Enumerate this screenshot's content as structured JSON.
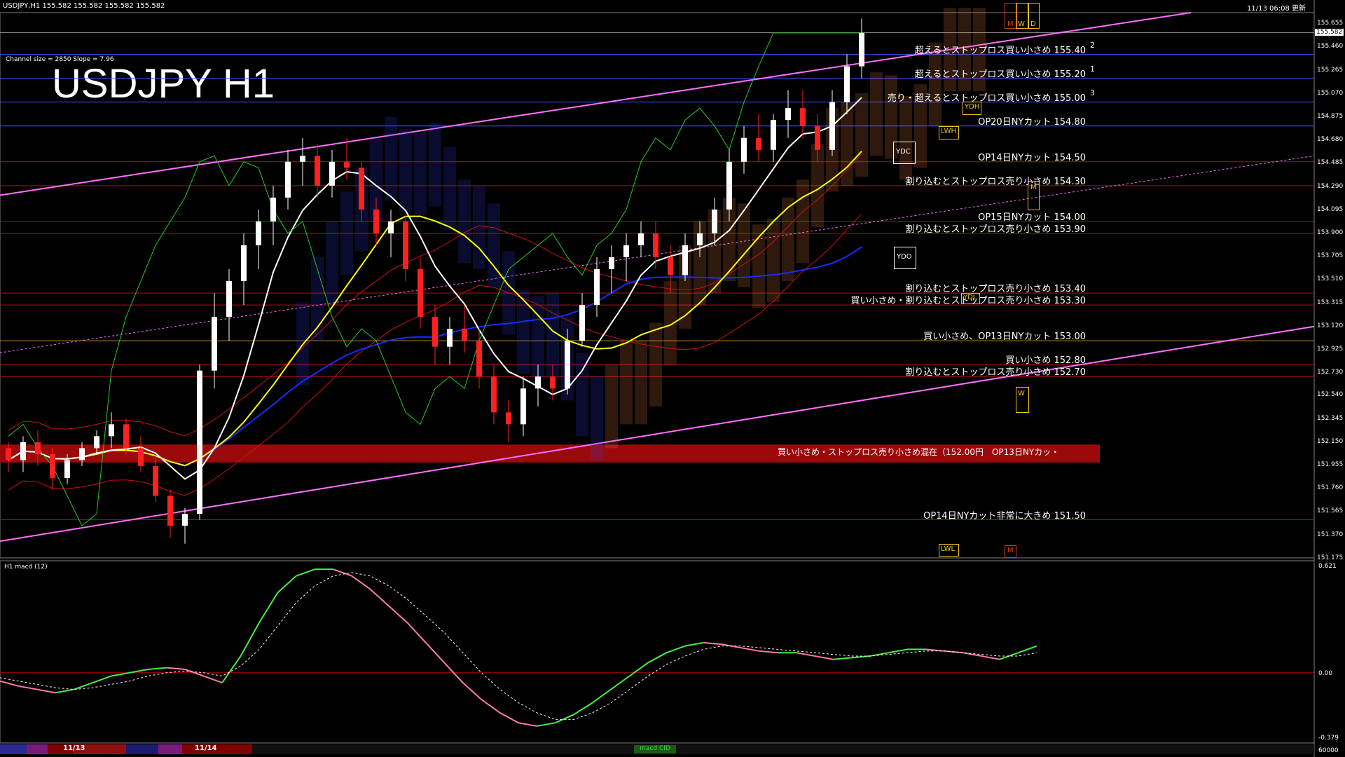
{
  "header": {
    "symbol_info": "USDJPY,H1  155.582 155.582 155.582 155.582",
    "datetime": "11/13 06:08 更新",
    "channel_info": "Channel size = 2850 Slope = 7.96",
    "title": "USDJPY H1"
  },
  "colors": {
    "background": "#000000",
    "bull_candle": "#ffffff",
    "bear_candle": "#ff2020",
    "sma_white": "#ffffff",
    "sma_yellow": "#ffff00",
    "sma_blue": "#1a2bff",
    "chikou_green": "#22cc22",
    "bollinger_red": "#cc1010",
    "channel_pink": "#ff70ff",
    "level_red": "#b01010",
    "level_blue": "#3a5aff",
    "kumo_orange": "#ff8a40",
    "kumo_blue": "#3040ff",
    "macd_up": "#44ee44",
    "macd_down": "#ff7ab0",
    "box_gold": "#f0c020"
  },
  "chart_data": {
    "type": "candlestick",
    "symbol": "USDJPY",
    "timeframe": "H1",
    "current_price": 155.582,
    "ylim": [
      151.18,
      155.75
    ],
    "y_ticks": [
      "155.655",
      "155.460",
      "155.265",
      "155.070",
      "154.875",
      "154.680",
      "154.485",
      "154.290",
      "154.095",
      "153.900",
      "153.705",
      "153.510",
      "153.315",
      "153.120",
      "152.925",
      "152.730",
      "152.540",
      "152.345",
      "152.150",
      "151.955",
      "151.760",
      "151.565",
      "151.370",
      "151.175"
    ],
    "candles": [
      [
        152.1,
        152.15,
        151.9,
        152.0
      ],
      [
        152.0,
        152.2,
        151.9,
        152.15
      ],
      [
        152.15,
        152.25,
        151.95,
        152.05
      ],
      [
        152.05,
        152.1,
        151.75,
        151.85
      ],
      [
        151.85,
        152.05,
        151.8,
        152.0
      ],
      [
        152.0,
        152.15,
        151.95,
        152.1
      ],
      [
        152.1,
        152.25,
        152.05,
        152.2
      ],
      [
        152.2,
        152.4,
        152.1,
        152.3
      ],
      [
        152.3,
        152.35,
        152.05,
        152.1
      ],
      [
        152.1,
        152.2,
        151.9,
        151.95
      ],
      [
        151.95,
        152.05,
        151.65,
        151.7
      ],
      [
        151.7,
        151.75,
        151.35,
        151.45
      ],
      [
        151.45,
        151.6,
        151.3,
        151.55
      ],
      [
        151.55,
        152.8,
        151.5,
        152.75
      ],
      [
        152.75,
        153.4,
        152.6,
        153.2
      ],
      [
        153.2,
        153.6,
        153.0,
        153.5
      ],
      [
        153.5,
        153.9,
        153.3,
        153.8
      ],
      [
        153.8,
        154.1,
        153.6,
        154.0
      ],
      [
        154.0,
        154.3,
        153.8,
        154.2
      ],
      [
        154.2,
        154.6,
        154.1,
        154.5
      ],
      [
        154.5,
        154.7,
        154.3,
        154.55
      ],
      [
        154.55,
        154.65,
        154.2,
        154.3
      ],
      [
        154.3,
        154.6,
        154.2,
        154.5
      ],
      [
        154.5,
        154.7,
        154.35,
        154.45
      ],
      [
        154.45,
        154.5,
        154.0,
        154.1
      ],
      [
        154.1,
        154.2,
        153.8,
        153.9
      ],
      [
        153.9,
        154.1,
        153.7,
        154.0
      ],
      [
        154.0,
        154.05,
        153.5,
        153.6
      ],
      [
        153.6,
        153.7,
        153.1,
        153.2
      ],
      [
        153.2,
        153.3,
        152.8,
        152.95
      ],
      [
        152.95,
        153.2,
        152.8,
        153.1
      ],
      [
        153.1,
        153.3,
        152.9,
        153.0
      ],
      [
        153.0,
        153.1,
        152.6,
        152.7
      ],
      [
        152.7,
        152.8,
        152.3,
        152.4
      ],
      [
        152.4,
        152.5,
        152.15,
        152.3
      ],
      [
        152.3,
        152.7,
        152.2,
        152.6
      ],
      [
        152.6,
        152.8,
        152.45,
        152.7
      ],
      [
        152.7,
        152.8,
        152.5,
        152.6
      ],
      [
        152.6,
        153.1,
        152.55,
        153.0
      ],
      [
        153.0,
        153.4,
        152.95,
        153.3
      ],
      [
        153.3,
        153.7,
        153.2,
        153.6
      ],
      [
        153.6,
        153.8,
        153.4,
        153.7
      ],
      [
        153.7,
        153.9,
        153.5,
        153.8
      ],
      [
        153.8,
        154.0,
        153.7,
        153.9
      ],
      [
        153.9,
        154.0,
        153.6,
        153.7
      ],
      [
        153.7,
        153.8,
        153.4,
        153.55
      ],
      [
        153.55,
        153.9,
        153.5,
        153.8
      ],
      [
        153.8,
        154.0,
        153.7,
        153.9
      ],
      [
        153.9,
        154.2,
        153.8,
        154.1
      ],
      [
        154.1,
        154.6,
        154.0,
        154.5
      ],
      [
        154.5,
        154.8,
        154.4,
        154.7
      ],
      [
        154.7,
        154.9,
        154.5,
        154.6
      ],
      [
        154.6,
        154.9,
        154.5,
        154.85
      ],
      [
        154.85,
        155.1,
        154.7,
        154.95
      ],
      [
        154.95,
        155.1,
        154.7,
        154.8
      ],
      [
        154.8,
        154.9,
        154.5,
        154.6
      ],
      [
        154.6,
        155.1,
        154.55,
        155.0
      ],
      [
        155.0,
        155.4,
        154.9,
        155.3
      ],
      [
        155.3,
        155.7,
        155.2,
        155.58
      ]
    ],
    "levels": [
      {
        "price": "155.40",
        "text": "超えるとストップロス買い小さめ 155.40",
        "color": "blue",
        "index": "2"
      },
      {
        "price": "155.20",
        "text": "超えるとストップロス買い小さめ 155.20",
        "color": "blue",
        "index": "1"
      },
      {
        "price": "155.00",
        "text": "売り・超えるとストップロス買い小さめ 155.00",
        "color": "blue",
        "index": "3"
      },
      {
        "price": "154.80",
        "text": "OP20日NYカット 154.80",
        "color": "blue",
        "index": ""
      },
      {
        "price": "154.50",
        "text": "OP14日NYカット 154.50",
        "color": "red",
        "index": ""
      },
      {
        "price": "154.30",
        "text": "割り込むとストップロス売り小さめ 154.30",
        "color": "red",
        "index": ""
      },
      {
        "price": "154.00",
        "text": "OP15日NYカット 154.00",
        "color": "red",
        "index": ""
      },
      {
        "price": "153.90",
        "text": "割り込むとストップロス売り小さめ 153.90",
        "color": "red",
        "index": ""
      },
      {
        "price": "153.40",
        "text": "割り込むとストップロス売り小さめ 153.40",
        "color": "red",
        "index": ""
      },
      {
        "price": "153.30",
        "text": "買い小さめ・割り込むとストップロス売り小さめ 153.30",
        "color": "red",
        "index": ""
      },
      {
        "price": "153.00",
        "text": "買い小さめ、OP13日NYカット 153.00",
        "color": "orange",
        "index": ""
      },
      {
        "price": "152.80",
        "text": "買い小さめ 152.80",
        "color": "red",
        "index": ""
      },
      {
        "price": "152.70",
        "text": "割り込むとストップロス売り小さめ 152.70",
        "color": "red",
        "index": ""
      },
      {
        "price": "151.50",
        "text": "OP14日NYカット非常に大きめ 151.50",
        "color": "red",
        "index": ""
      }
    ],
    "band_label": "買い小さめ・ストップロス売り小さめ混在（152.00円　OP13日NYカッ・",
    "box_labels": [
      "YDH",
      "LWH",
      "YDC",
      "YDO",
      "YDL",
      "LWL",
      "M",
      "W",
      "D",
      "M",
      "W",
      "M"
    ],
    "macd": {
      "label": "H1  macd (12)",
      "ticks": [
        "0.621",
        "0.00",
        "-0.379"
      ],
      "status_label": "macd CID",
      "volume_label": "60000",
      "ylim": [
        -0.4,
        0.65
      ],
      "main": [
        -0.05,
        -0.08,
        -0.1,
        -0.12,
        -0.1,
        -0.06,
        -0.02,
        0.0,
        0.02,
        0.03,
        0.02,
        -0.02,
        -0.06,
        0.1,
        0.3,
        0.48,
        0.58,
        0.62,
        0.62,
        0.58,
        0.5,
        0.4,
        0.3,
        0.18,
        0.06,
        -0.06,
        -0.16,
        -0.24,
        -0.3,
        -0.32,
        -0.3,
        -0.25,
        -0.18,
        -0.1,
        -0.02,
        0.06,
        0.12,
        0.16,
        0.18,
        0.17,
        0.15,
        0.13,
        0.12,
        0.12,
        0.1,
        0.08,
        0.09,
        0.1,
        0.12,
        0.14,
        0.14,
        0.13,
        0.12,
        0.1,
        0.08,
        0.12,
        0.16
      ],
      "signal": [
        -0.03,
        -0.05,
        -0.07,
        -0.09,
        -0.1,
        -0.09,
        -0.07,
        -0.05,
        -0.02,
        0.0,
        0.01,
        0.0,
        -0.02,
        0.04,
        0.14,
        0.28,
        0.42,
        0.52,
        0.58,
        0.6,
        0.58,
        0.52,
        0.44,
        0.34,
        0.24,
        0.12,
        0.0,
        -0.1,
        -0.18,
        -0.24,
        -0.28,
        -0.28,
        -0.24,
        -0.18,
        -0.1,
        -0.02,
        0.05,
        0.1,
        0.14,
        0.16,
        0.16,
        0.15,
        0.14,
        0.13,
        0.12,
        0.11,
        0.1,
        0.1,
        0.11,
        0.12,
        0.13,
        0.13,
        0.12,
        0.11,
        0.1,
        0.1,
        0.12
      ]
    },
    "date_labels": [
      "11/13",
      "11/14"
    ]
  }
}
